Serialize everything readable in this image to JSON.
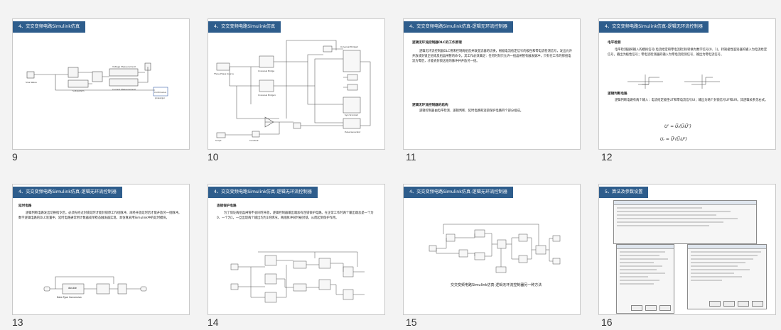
{
  "slides": [
    {
      "number": "9",
      "header": "4、交交变频电路Simulink仿真"
    },
    {
      "number": "10",
      "header": "4、交交变频电路Simulink仿真"
    },
    {
      "number": "11",
      "header": "4、交交变频电路Simulink仿真-逻辑无环流控制器",
      "heading1": "逻辑无环流控制器DLC的工作原理",
      "para1": "逻辑无环流控制器DLC用来控制两组反并联变流器的切换，根据电流给定信号的极性和零电流检测信号，发出允许开放或封锁正组或反组晶闸管的命令。其工作必须满足：任何时刻只允许一组晶闸管有触发脉冲，只有在工作的那组电流为零后，才能去封锁这组的脉冲并开放另一组。",
      "heading2": "逻辑无环流控制器的结构",
      "para2": "逻辑控制器由电平检测、逻辑判断、延时电路和连锁保护电路四个部分组成。"
    },
    {
      "number": "12",
      "header": "4、交交变频电路Simulink仿真-逻辑无环流控制器",
      "heading1": "电平检测",
      "para1": "电平检测器将输入的模拟信号(电流给定和零电流检测)转换为数字信号(0、1)。转矩极性鉴别器的输入为电流给定信号，输出为极性信号；零电流检测器的输入为零电流检测信号，输出为零电流信号。",
      "heading2": "逻辑判断电路",
      "para2": "逻辑判断电路有两个输入：电流给定极性UT和零电流信号UI；输出为两个封锁信号UF和UR。其逻辑关系见右式。",
      "eq1": "Uᶠ = U̅ᵣ(U̅ᵢU̅ᵀ)",
      "eq2": "Uᵣ = U̅ᶠ(U̅ᵢUᵀ)"
    },
    {
      "number": "13",
      "header": "4、交交变频电路Simulink仿真-逻辑无环流控制器",
      "heading1": "延时电路",
      "para1": "逻辑判断电路发出切换指令后，必须先经过封锁延时才能封锁原工作组脉冲，再经开放延时后才能开放另一组脉冲。数字逻辑电路的DLC装置中，延时电路通常用计数器或单稳态触发器实现，本仿真采用Simulink中的延时模块。",
      "block_label": "Data Type Conversion",
      "block_text": "double"
    },
    {
      "number": "14",
      "header": "4、交交变频电路Simulink仿真-逻辑无环流控制器",
      "heading1": "连锁保护电路",
      "para1": "为了保证两组晶闸管不会同时开放，逻辑控制器输出端加有连锁保护电路。在正常工作时两个输出端总是一个为0、一个为1，一旦出现两个输出均为1的情况，两组脉冲同时被封锁，从而起到保护作用。"
    },
    {
      "number": "15",
      "header": "4、交交变频电路Simulink仿真-逻辑无环流控制器",
      "caption": "交交变频电路Simulink仿真-逻辑无环流控制器另一种方法"
    },
    {
      "number": "16",
      "header": "5、算法及参数设置"
    }
  ]
}
